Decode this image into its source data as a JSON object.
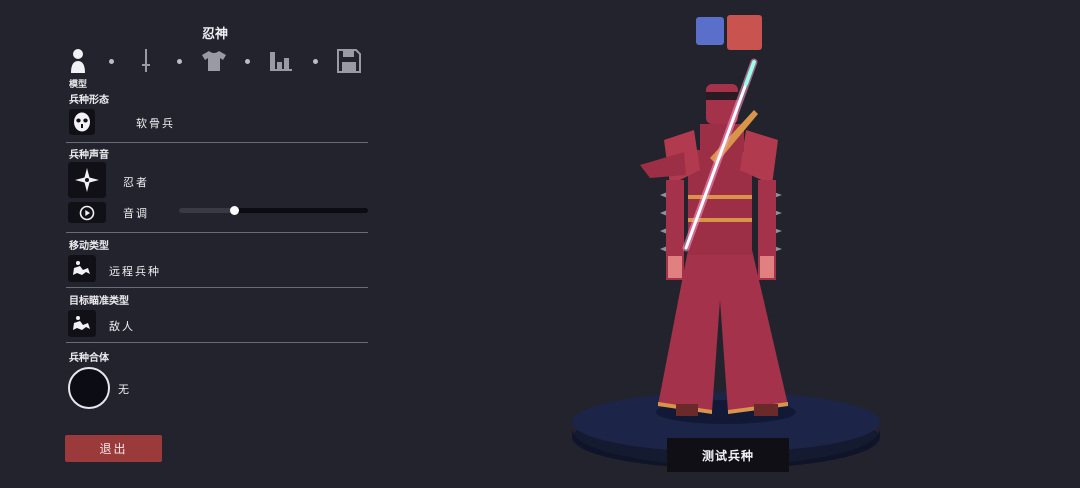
{
  "header": {
    "title": "忍神"
  },
  "tabs": [
    {
      "icon": "person-icon",
      "label": "模型"
    },
    {
      "icon": "sword-icon"
    },
    {
      "icon": "shirt-icon"
    },
    {
      "icon": "stats-icon"
    },
    {
      "icon": "save-icon"
    }
  ],
  "form": {
    "unit_form": {
      "label": "兵种形态",
      "value": "软骨兵",
      "icon": "mask-icon"
    },
    "unit_voice": {
      "label": "兵种声音",
      "value": "忍者",
      "icon": "shuriken-icon",
      "pitch_label": "音调",
      "pitch_level": 0.29
    },
    "movement": {
      "label": "移动类型",
      "value": "远程兵种",
      "icon": "movement-icon"
    },
    "targeting": {
      "label": "目标瞄准类型",
      "value": "敌人",
      "icon": "target-icon"
    },
    "combine": {
      "label": "兵种合体",
      "value": "无"
    }
  },
  "actions": {
    "exit_label": "退出",
    "test_label": "测试兵种"
  },
  "colors": {
    "team_blue": "#5a6fc9",
    "team_red": "#c9544f",
    "exit": "#9a3a3a",
    "accent_robe": "#a3324a"
  }
}
